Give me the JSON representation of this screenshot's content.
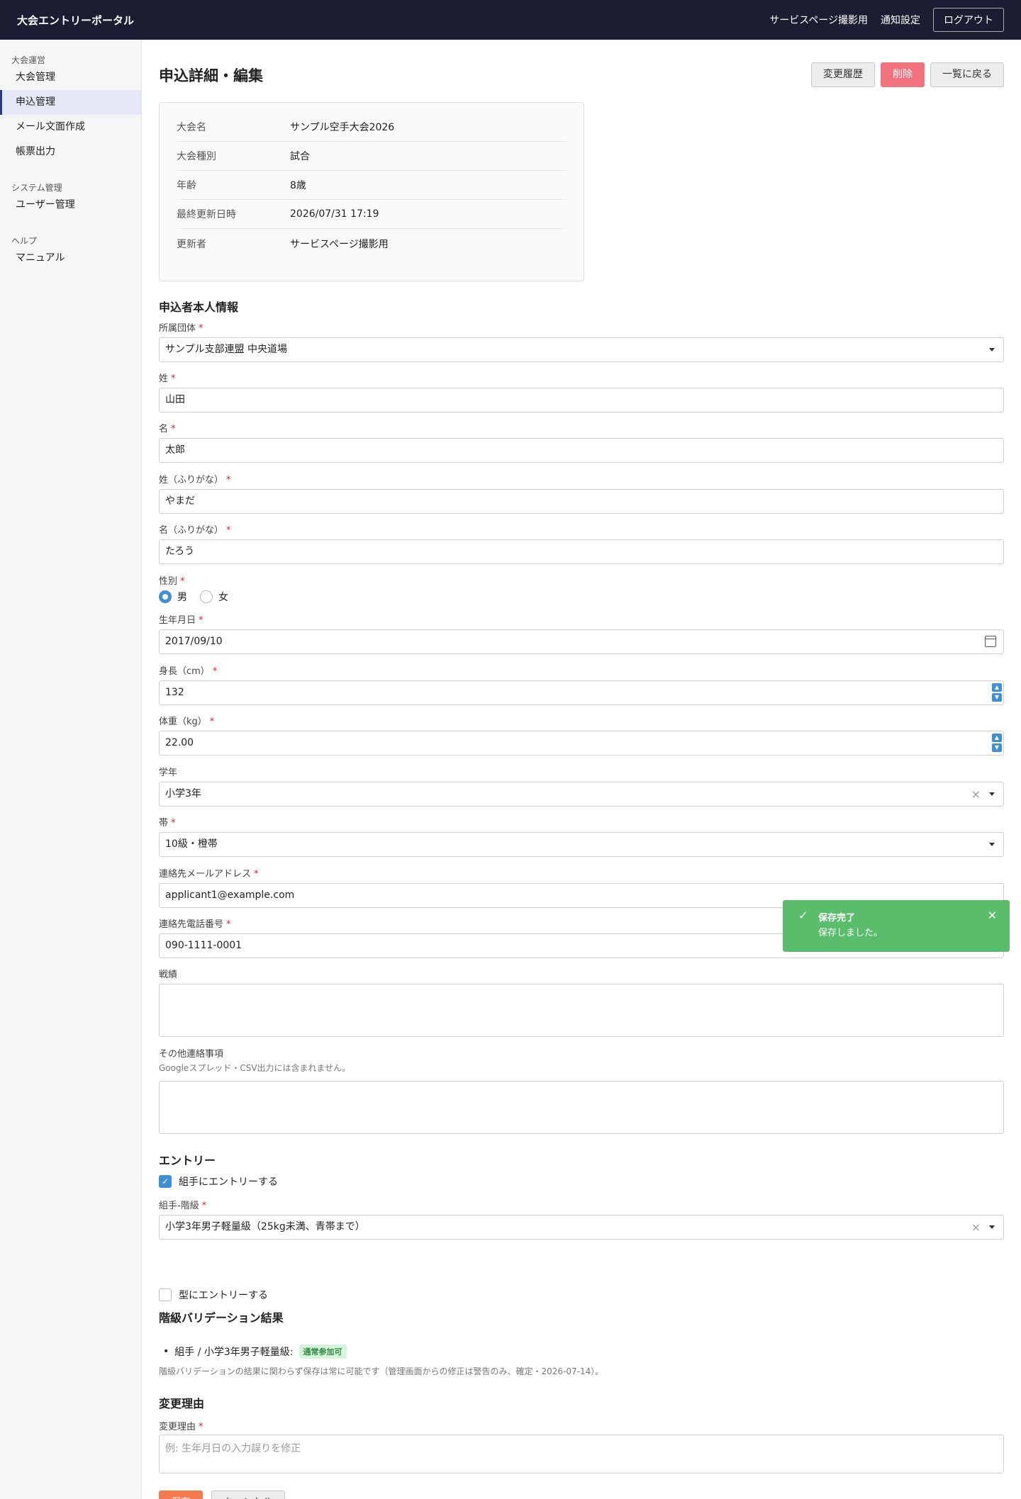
{
  "header": {
    "brand": "大会エントリーポータル",
    "user": "サービスページ撮影用",
    "notify": "通知設定",
    "logout": "ログアウト"
  },
  "sidebar": {
    "sec1": "大会運営",
    "i1": "大会管理",
    "i2": "申込管理",
    "i3": "メール文面作成",
    "i4": "帳票出力",
    "sec2": "システム管理",
    "i5": "ユーザー管理",
    "sec3": "ヘルプ",
    "i6": "マニュアル"
  },
  "page": {
    "title": "申込詳細・編集",
    "history": "変更履歴",
    "delete": "削除",
    "back": "一覧に戻る"
  },
  "summary": [
    {
      "label": "大会名",
      "value": "サンプル空手大会2026"
    },
    {
      "label": "大会種別",
      "value": "試合"
    },
    {
      "label": "年齢",
      "value": "8歳"
    },
    {
      "label": "最終更新日時",
      "value": "2026/07/31 17:19"
    },
    {
      "label": "更新者",
      "value": "サービスページ撮影用"
    }
  ],
  "applicant": {
    "section": "申込者本人情報",
    "org_label": "所属団体",
    "org": "サンプル支部連盟 中央道場",
    "last_label": "姓",
    "last": "山田",
    "first_label": "名",
    "first": "太郎",
    "lastk_label": "姓（ふりがな）",
    "lastk": "やまだ",
    "firstk_label": "名（ふりがな）",
    "firstk": "たろう",
    "gender_label": "性別",
    "male": "男",
    "female": "女",
    "gender_selected": "男",
    "birth_label": "生年月日",
    "birth": "2017/09/10",
    "height_label": "身長（cm）",
    "height": "132",
    "weight_label": "体重（kg）",
    "weight": "22.00",
    "grade_label": "学年",
    "grade": "小学3年",
    "belt_label": "帯",
    "belt": "10級・橙帯",
    "email_label": "連絡先メールアドレス",
    "email": "applicant1@example.com",
    "phone_label": "連絡先電話番号",
    "phone": "090-1111-0001",
    "record_label": "戦績",
    "other_label": "その他連絡事項",
    "other_note": "Googleスプレッド・CSV出力には含まれません。"
  },
  "entry": {
    "section": "エントリー",
    "kumite_chk": "組手にエントリーする",
    "kumite_checked": true,
    "class_label": "組手-階級",
    "class": "小学3年男子軽量級（25kg未満、青帯まで）",
    "kata_chk": "型にエントリーする",
    "kata_checked": false
  },
  "validation": {
    "section": "階級バリデーション結果",
    "item": "組手 / 小学3年男子軽量級:",
    "badge": "通常参加可",
    "note": "階級バリデーションの結果に関わらず保存は常に可能です（管理画面からの修正は警告のみ、確定・2026-07-14）。"
  },
  "reason": {
    "section": "変更理由",
    "label": "変更理由",
    "placeholder": "例: 生年月日の入力誤りを修正"
  },
  "footer": {
    "save": "保存",
    "cancel": "キャンセル"
  },
  "toast": {
    "title": "保存完了",
    "message": "保存しました。"
  },
  "colors": {
    "topbar": "#1b1e33",
    "accent": "#3d8fd6",
    "save": "#f77a4e",
    "delete": "#f0737f",
    "toast": "#5abd6c"
  }
}
